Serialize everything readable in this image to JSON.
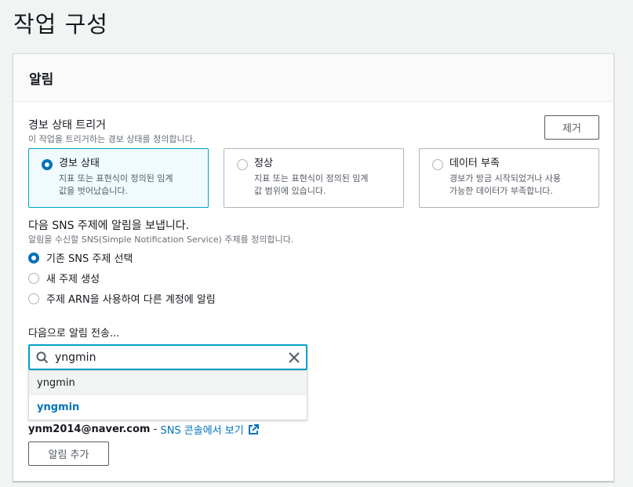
{
  "page": {
    "title": "작업 구성"
  },
  "panel": {
    "header": "알림",
    "trigger": {
      "label": "경보 상태 트리거",
      "description": "이 작업을 트리거하는 경보 상태를 정의합니다.",
      "remove_label": "제거",
      "tiles": [
        {
          "title": "경보 상태",
          "desc1": "지표 또는 표현식이 정의된 임계",
          "desc2": "값을 벗어났습니다.",
          "selected": true
        },
        {
          "title": "정상",
          "desc1": "지표 또는 표현식이 정의된 임계",
          "desc2": "값 범위에 있습니다.",
          "selected": false
        },
        {
          "title": "데이터 부족",
          "desc1": "경보가 방금 시작되었거나 사용",
          "desc2": "가능한 데이터가 부족합니다.",
          "selected": false
        }
      ]
    },
    "sns": {
      "label": "다음 SNS 주제에 알림을 보냅니다.",
      "description": "알림을 수신할 SNS(Simple Notification Service) 주제를 정의합니다.",
      "options": [
        {
          "label": "기존 SNS 주제 선택",
          "selected": true
        },
        {
          "label": "새 주제 생성",
          "selected": false
        },
        {
          "label": "주제 ARN을 사용하여 다른 계정에 알림",
          "selected": false
        }
      ]
    },
    "send_to": {
      "label": "다음으로 알림 전송...",
      "search_value": "yngmin",
      "suggestions": [
        "yngmin",
        "yngmin"
      ]
    },
    "endpoint": {
      "email": "ynm2014@naver.com",
      "separator": " - ",
      "link_text": "SNS 콘솔에서 보기"
    },
    "add_notification_label": "알림 추가"
  },
  "colors": {
    "accent": "#0073bb",
    "focus": "#00a1c9"
  }
}
